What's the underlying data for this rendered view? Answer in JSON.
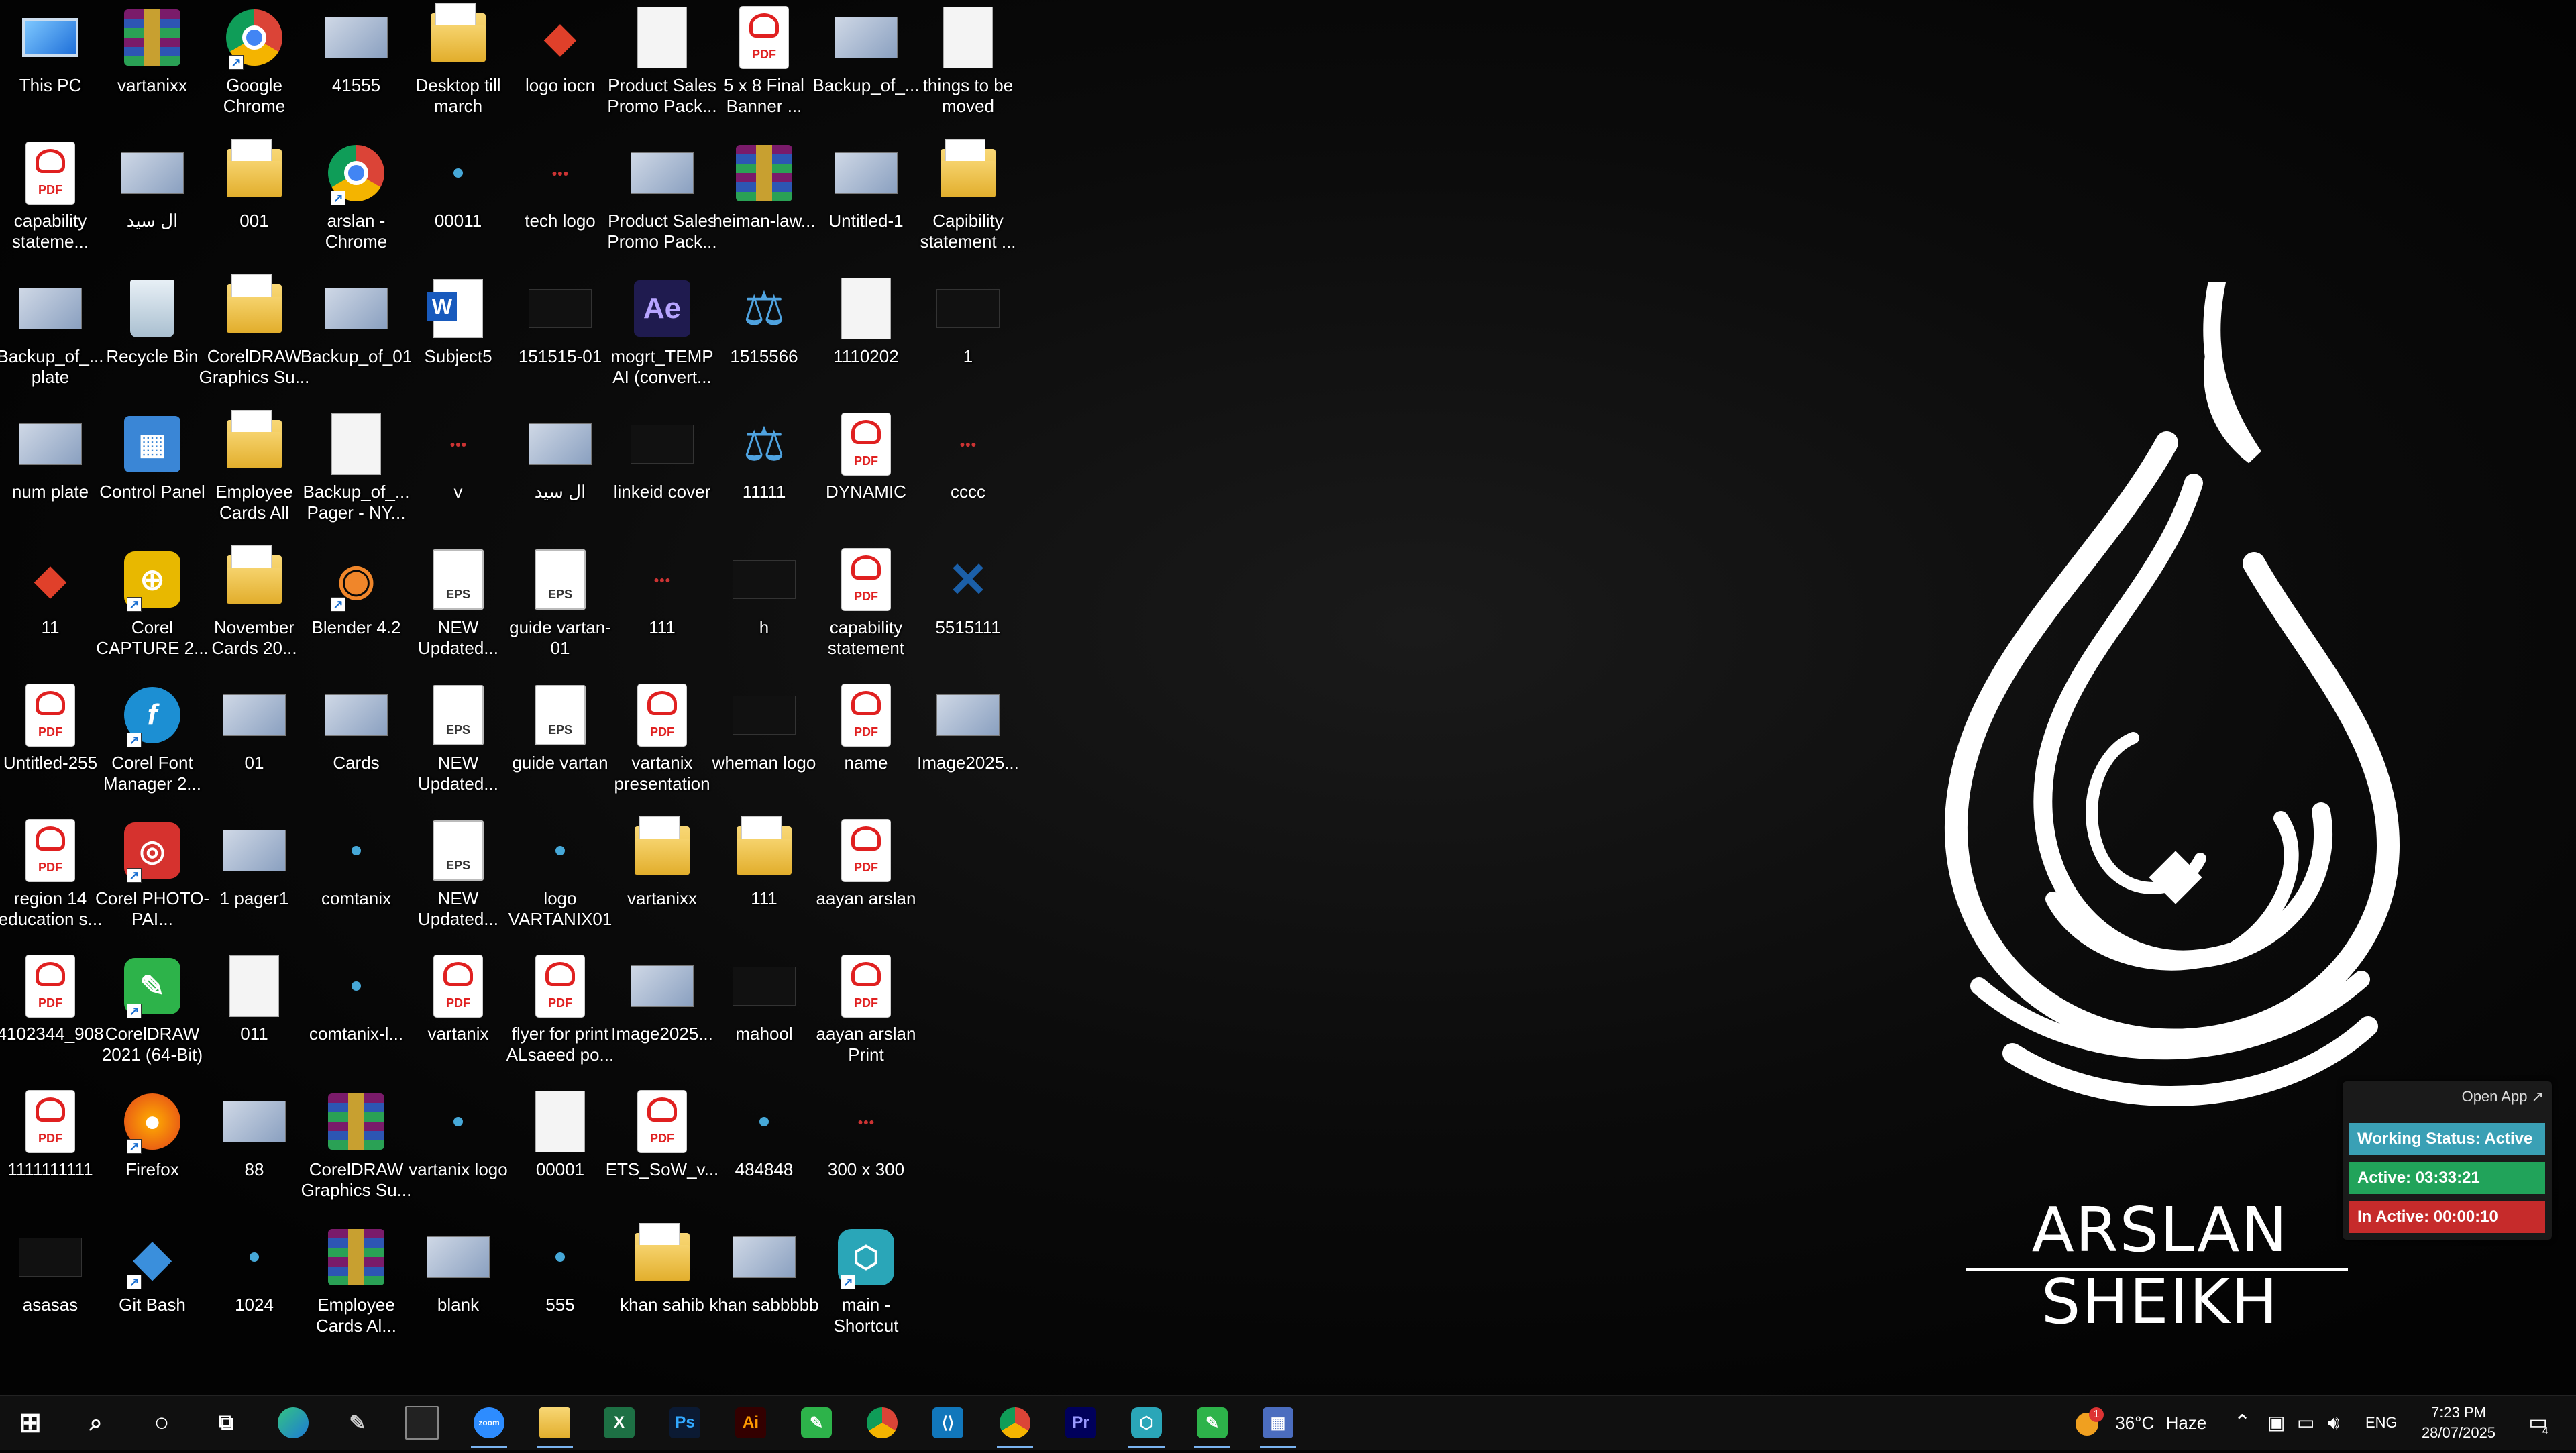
{
  "desktop": {
    "icons": [
      {
        "label": "This PC",
        "type": "pc"
      },
      {
        "label": "vartanixx",
        "type": "rar"
      },
      {
        "label": "Google Chrome",
        "type": "chrome",
        "shortcut": true
      },
      {
        "label": "41555",
        "type": "img"
      },
      {
        "label": "Desktop till march",
        "type": "folder"
      },
      {
        "label": "logo iocn",
        "type": "logo"
      },
      {
        "label": "Product Sales Promo Pack...",
        "type": "white"
      },
      {
        "label": "5 x 8 Final Banner ...",
        "type": "pdf"
      },
      {
        "label": "Backup_of_...",
        "type": "img"
      },
      {
        "label": "things to be moved",
        "type": "white"
      },
      {
        "label": "capability stateme...",
        "type": "pdf"
      },
      {
        "label": "ال سید",
        "type": "img"
      },
      {
        "label": "001",
        "type": "folder"
      },
      {
        "label": "arslan - Chrome",
        "type": "chrome",
        "shortcut": true
      },
      {
        "label": "00011",
        "type": "dot"
      },
      {
        "label": "tech logo",
        "type": "tiny"
      },
      {
        "label": "Product Sales Promo Pack...",
        "type": "img"
      },
      {
        "label": "heiman-law...",
        "type": "rar"
      },
      {
        "label": "Untitled-1",
        "type": "img"
      },
      {
        "label": "Capibility statement ...",
        "type": "folder"
      },
      {
        "label": "Backup_of_... plate",
        "type": "img"
      },
      {
        "label": "Recycle Bin",
        "type": "trash"
      },
      {
        "label": "CorelDRAW Graphics Su...",
        "type": "folder"
      },
      {
        "label": "Backup_of_01",
        "type": "img"
      },
      {
        "label": "Subject5",
        "type": "word"
      },
      {
        "label": "151515-01",
        "type": "dark"
      },
      {
        "label": "mogrt_TEMP AI (convert...",
        "type": "ae"
      },
      {
        "label": "1515566",
        "type": "scale"
      },
      {
        "label": "1110202",
        "type": "white"
      },
      {
        "label": "1",
        "type": "dark"
      },
      {
        "label": "num plate",
        "type": "img"
      },
      {
        "label": "Control Panel",
        "type": "cp"
      },
      {
        "label": "Employee Cards All",
        "type": "folder"
      },
      {
        "label": "Backup_of_... Pager - NY...",
        "type": "white"
      },
      {
        "label": "v",
        "type": "tiny"
      },
      {
        "label": "ال سید",
        "type": "img"
      },
      {
        "label": "linkeid cover",
        "type": "dark"
      },
      {
        "label": "11111",
        "type": "scale"
      },
      {
        "label": "DYNAMIC",
        "type": "pdf"
      },
      {
        "label": "cccc",
        "type": "tiny"
      },
      {
        "label": "11",
        "type": "logo"
      },
      {
        "label": "Corel CAPTURE 2...",
        "type": "capture",
        "shortcut": true
      },
      {
        "label": "November Cards 20...",
        "type": "folder"
      },
      {
        "label": "Blender 4.2",
        "type": "blender",
        "shortcut": true
      },
      {
        "label": "NEW Updated...",
        "type": "eps"
      },
      {
        "label": "guide vartan-01",
        "type": "eps"
      },
      {
        "label": "111",
        "type": "tiny"
      },
      {
        "label": "h",
        "type": "dark"
      },
      {
        "label": "capability statement",
        "type": "pdf"
      },
      {
        "label": "5515111",
        "type": "x"
      },
      {
        "label": "Untitled-255",
        "type": "pdf"
      },
      {
        "label": "Corel Font Manager 2...",
        "type": "font",
        "shortcut": true
      },
      {
        "label": "01",
        "type": "img"
      },
      {
        "label": "Cards",
        "type": "img"
      },
      {
        "label": "NEW Updated...",
        "type": "eps"
      },
      {
        "label": "guide vartan",
        "type": "eps"
      },
      {
        "label": "vartanix presentation",
        "type": "pdf"
      },
      {
        "label": "wheman logo",
        "type": "dark"
      },
      {
        "label": "name",
        "type": "pdf"
      },
      {
        "label": "Image2025...",
        "type": "img"
      },
      {
        "label": "region 14 education s...",
        "type": "pdf"
      },
      {
        "label": "Corel PHOTO-PAI...",
        "type": "photopaint",
        "shortcut": true
      },
      {
        "label": "1 pager1",
        "type": "img"
      },
      {
        "label": "comtanix",
        "type": "dot"
      },
      {
        "label": "NEW Updated...",
        "type": "eps"
      },
      {
        "label": "logo VARTANIX01",
        "type": "dot"
      },
      {
        "label": "vartanixx",
        "type": "folder"
      },
      {
        "label": "111",
        "type": "folder"
      },
      {
        "label": "aayan arslan",
        "type": "pdf"
      },
      {
        "label": "",
        "type": "none"
      },
      {
        "label": "4102344_908",
        "type": "pdf"
      },
      {
        "label": "CorelDRAW 2021 (64-Bit)",
        "type": "cdr",
        "shortcut": true
      },
      {
        "label": "011",
        "type": "white"
      },
      {
        "label": "comtanix-l...",
        "type": "dot"
      },
      {
        "label": "vartanix",
        "type": "pdf"
      },
      {
        "label": "flyer for print ALsaeed po...",
        "type": "pdf"
      },
      {
        "label": "Image2025...",
        "type": "img"
      },
      {
        "label": "mahool",
        "type": "dark"
      },
      {
        "label": "aayan arslan Print",
        "type": "pdf"
      },
      {
        "label": "",
        "type": "none"
      },
      {
        "label": "1111111111",
        "type": "pdf"
      },
      {
        "label": "Firefox",
        "type": "firefox",
        "shortcut": true
      },
      {
        "label": "88",
        "type": "img"
      },
      {
        "label": "CorelDRAW Graphics Su...",
        "type": "rar"
      },
      {
        "label": "vartanix logo",
        "type": "dot"
      },
      {
        "label": "00001",
        "type": "white"
      },
      {
        "label": "ETS_SoW_v...",
        "type": "pdf"
      },
      {
        "label": "484848",
        "type": "dot"
      },
      {
        "label": "300 x 300",
        "type": "tiny"
      },
      {
        "label": "",
        "type": "none"
      },
      {
        "label": "asasas",
        "type": "dark"
      },
      {
        "label": "Git Bash",
        "type": "git",
        "shortcut": true
      },
      {
        "label": "1024",
        "type": "dot"
      },
      {
        "label": "Employee Cards Al...",
        "type": "rar"
      },
      {
        "label": "blank",
        "type": "img"
      },
      {
        "label": "555",
        "type": "dot"
      },
      {
        "label": "khan sahib",
        "type": "folder"
      },
      {
        "label": "khan sabbbbb",
        "type": "img"
      },
      {
        "label": "main - Shortcut",
        "type": "main",
        "shortcut": true
      },
      {
        "label": "",
        "type": "none"
      }
    ]
  },
  "brand": {
    "name": "ARSLAN SHEIKH"
  },
  "widget": {
    "open_app": "Open App ↗",
    "working_status": "Working Status: Active",
    "active": "Active: 03:33:21",
    "inactive": "In Active: 00:00:10",
    "colors": {
      "status": "#3aa0b5",
      "active": "#21a35a",
      "inactive": "#c62b2b"
    }
  },
  "taskbar": {
    "apps": [
      {
        "name": "start-button",
        "icon": "windows-icon"
      },
      {
        "name": "search-button",
        "icon": "search-icon"
      },
      {
        "name": "cortana-button",
        "icon": "circle-icon"
      },
      {
        "name": "task-view-button",
        "icon": "task-view-icon"
      },
      {
        "name": "edge-app",
        "icon": "edge-icon"
      },
      {
        "name": "pen-app",
        "icon": "pen-icon"
      },
      {
        "name": "terminal-app",
        "icon": "terminal-icon"
      },
      {
        "name": "zoom-app",
        "icon": "zoom-icon",
        "label": "zoom",
        "running": true
      },
      {
        "name": "file-explorer-app",
        "icon": "folder-icon",
        "running": true
      },
      {
        "name": "excel-app",
        "icon": "excel-icon",
        "label": "X"
      },
      {
        "name": "photoshop-app",
        "icon": "photoshop-icon",
        "label": "Ps"
      },
      {
        "name": "illustrator-app",
        "icon": "illustrator-icon",
        "label": "Ai"
      },
      {
        "name": "coreldraw-app",
        "icon": "coreldraw-icon"
      },
      {
        "name": "chrome-app",
        "icon": "chrome-icon"
      },
      {
        "name": "vscode-app",
        "icon": "vscode-icon"
      },
      {
        "name": "chrome-profile-app",
        "icon": "chrome-icon",
        "running": true
      },
      {
        "name": "premiere-app",
        "icon": "premiere-icon",
        "label": "Pr"
      },
      {
        "name": "main-app",
        "icon": "main-icon",
        "running": true
      },
      {
        "name": "coreldraw-running-app",
        "icon": "coreldraw-icon",
        "running": true
      },
      {
        "name": "calculator-app",
        "icon": "calculator-icon",
        "running": true
      }
    ],
    "weather": {
      "temp": "36°C",
      "condition": "Haze",
      "alert": "1"
    },
    "language": "ENG",
    "time": "7:23 PM",
    "date": "28/07/2025",
    "notifications": "4"
  }
}
